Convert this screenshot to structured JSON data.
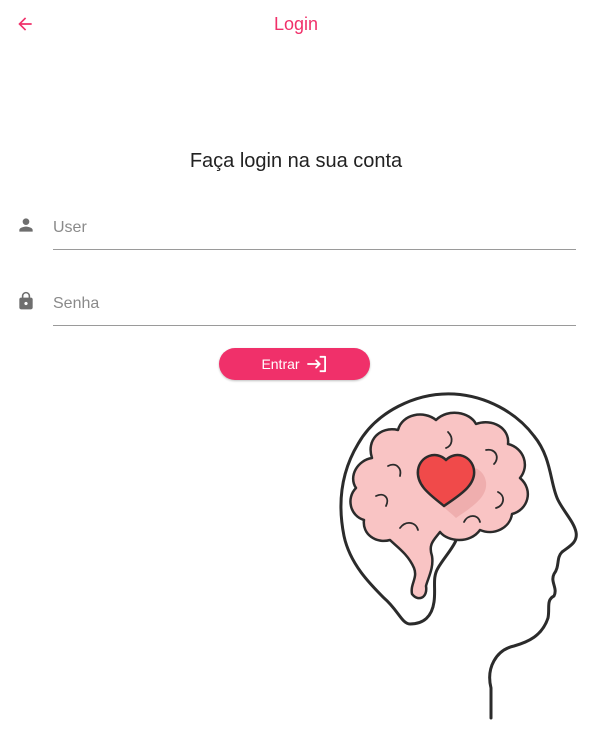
{
  "appbar": {
    "title": "Login",
    "back_icon": "arrow-back-icon"
  },
  "heading": "Faça login na sua conta",
  "form": {
    "user": {
      "placeholder": "User",
      "value": "",
      "icon": "person-icon"
    },
    "password": {
      "placeholder": "Senha",
      "value": "",
      "icon": "lock-icon"
    }
  },
  "login_button": {
    "label": "Entrar",
    "icon": "login-icon"
  },
  "illustration": {
    "name": "brain-heart-illustration"
  },
  "colors": {
    "accent": "#f0306a",
    "brain": "#f9c4c4",
    "heart": "#f04a4a",
    "icon_gray": "#6e6e6e"
  }
}
